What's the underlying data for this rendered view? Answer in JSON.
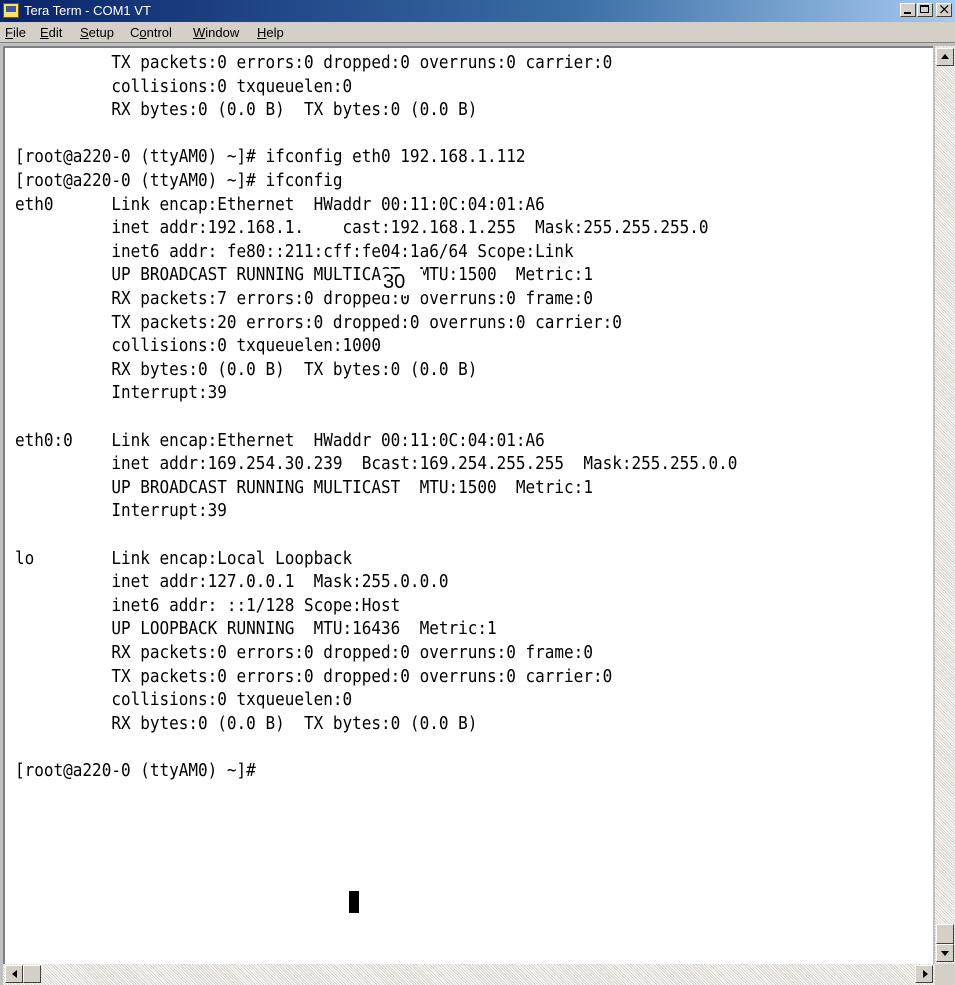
{
  "window": {
    "title": "Tera Term - COM1 VT",
    "menu": [
      {
        "mnemonic": "F",
        "rest": "ile"
      },
      {
        "mnemonic": "E",
        "rest": "dit"
      },
      {
        "mnemonic": "S",
        "rest": "etup"
      },
      {
        "mnemonic": "",
        "pre": "C",
        "mnemonic2": "o",
        "rest": "ntrol"
      },
      {
        "mnemonic": "W",
        "rest": "indow"
      },
      {
        "mnemonic": "H",
        "rest": "elp"
      }
    ]
  },
  "terminal": {
    "lines": [
      "          TX packets:0 errors:0 dropped:0 overruns:0 carrier:0",
      "          collisions:0 txqueuelen:0",
      "          RX bytes:0 (0.0 B)  TX bytes:0 (0.0 B)",
      "",
      "[root@a220-0 (ttyAM0) ~]# ifconfig eth0 192.168.1.112",
      "[root@a220-0 (ttyAM0) ~]# ifconfig",
      "eth0      Link encap:Ethernet  HWaddr 00:11:0C:04:01:A6",
      "          inet addr:192.168.1.    cast:192.168.1.255  Mask:255.255.255.0",
      "          inet6 addr: fe80::211:cff:fe04:1a6/64 Scope:Link",
      "          UP BROADCAST RUNNING MULTICAST  MTU:1500  Metric:1",
      "          RX packets:7 errors:0 dropped:0 overruns:0 frame:0",
      "          TX packets:20 errors:0 dropped:0 overruns:0 carrier:0",
      "          collisions:0 txqueuelen:1000",
      "          RX bytes:0 (0.0 B)  TX bytes:0 (0.0 B)",
      "          Interrupt:39",
      "",
      "eth0:0    Link encap:Ethernet  HWaddr 00:11:0C:04:01:A6",
      "          inet addr:169.254.30.239  Bcast:169.254.255.255  Mask:255.255.0.0",
      "          UP BROADCAST RUNNING MULTICAST  MTU:1500  Metric:1",
      "          Interrupt:39",
      "",
      "lo        Link encap:Local Loopback",
      "          inet addr:127.0.0.1  Mask:255.0.0.0",
      "          inet6 addr: ::1/128 Scope:Host",
      "          UP LOOPBACK RUNNING  MTU:16436  Metric:1",
      "          RX packets:0 errors:0 dropped:0 overruns:0 frame:0",
      "          TX packets:0 errors:0 dropped:0 overruns:0 carrier:0",
      "          collisions:0 txqueuelen:0",
      "          RX bytes:0 (0.0 B)  TX bytes:0 (0.0 B)",
      "",
      "[root@a220-0 (ttyAM0) ~]# "
    ],
    "overlay_number": "30"
  },
  "icons": {
    "app": "tera-term-icon",
    "minimize": "minimize-icon",
    "maximize": "maximize-icon",
    "close": "close-icon"
  },
  "colors": {
    "titlebar_start": "#0a246a",
    "titlebar_end": "#a6caf0",
    "chrome": "#d4d0c8",
    "terminal_bg": "#ffffff",
    "terminal_fg": "#000000"
  }
}
